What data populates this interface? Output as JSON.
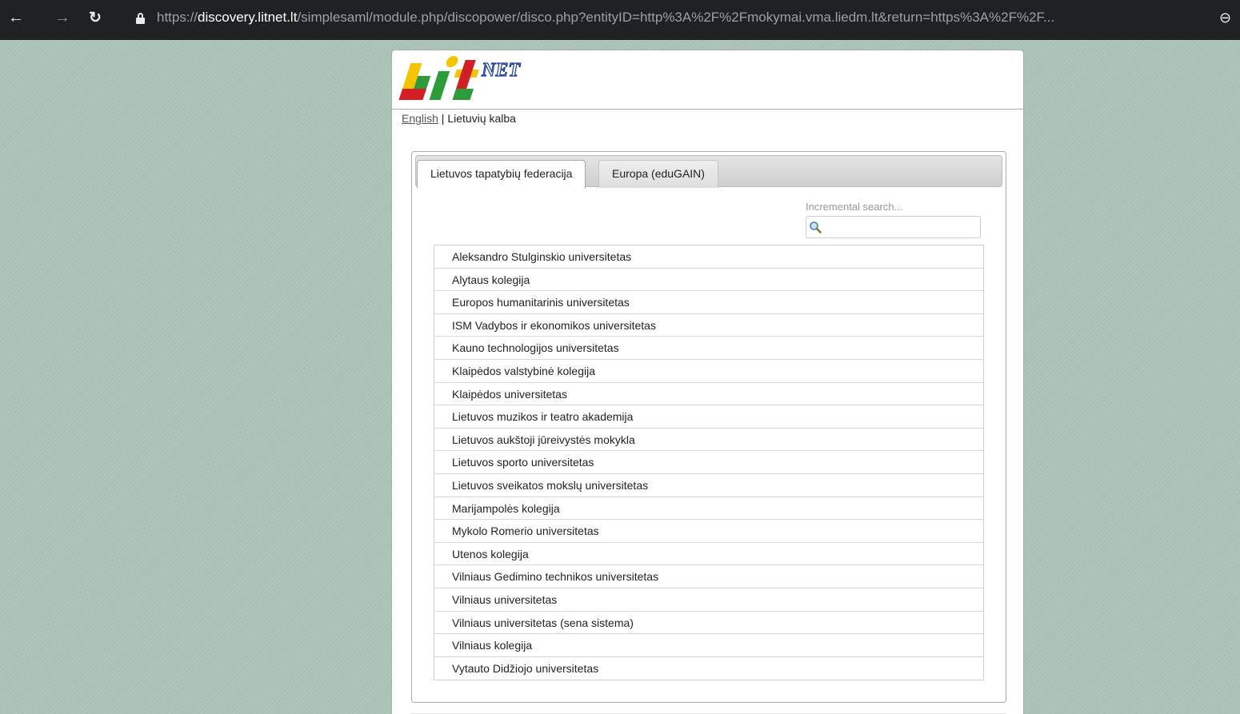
{
  "browser": {
    "url_scheme": "https://",
    "url_host": "discovery.litnet.lt",
    "url_path": "/simplesaml/module.php/discopower/disco.php?entityID=http%3A%2F%2Fmokymai.vma.liedm.lt&return=https%3A%2F%2F...",
    "back_icon": "arrow-left-icon",
    "forward_icon": "arrow-right-icon",
    "reload_icon": "reload-icon",
    "zoom_icon": "zoom-icon"
  },
  "logo": {
    "text_main": "Lit",
    "text_sup": "NET"
  },
  "language": {
    "english": "English",
    "separator": " | ",
    "lithuanian": "Lietuvių kalba"
  },
  "tabs": [
    {
      "label": "Lietuvos tapatybių federacija",
      "active": true
    },
    {
      "label": "Europa (eduGAIN)",
      "active": false
    }
  ],
  "search": {
    "placeholder": "Incremental search...",
    "value": ""
  },
  "institutions": [
    "Aleksandro Stulginskio universitetas",
    "Alytaus kolegija",
    "Europos humanitarinis universitetas",
    "ISM Vadybos ir ekonomikos universitetas",
    "Kauno technologijos universitetas",
    "Klaipėdos valstybinė kolegija",
    "Klaipėdos universitetas",
    "Lietuvos muzikos ir teatro akademija",
    "Lietuvos aukštoji jūreivystės mokykla",
    "Lietuvos sporto universitetas",
    "Lietuvos sveikatos mokslų universitetas",
    "Marijampolės kolegija",
    "Mykolo Romerio universitetas",
    "Utenos kolegija",
    "Vilniaus Gedimino technikos universitetas",
    "Vilniaus universitetas",
    "Vilniaus universitetas (sena sistema)",
    "Vilniaus kolegija",
    "Vytauto Didžiojo universitetas"
  ],
  "colors": {
    "background": "#a9c2b5",
    "logo_red": "#d21f26",
    "logo_yellow": "#f5c400",
    "logo_green": "#2e9b3a",
    "logo_blue": "#1a3a9c"
  }
}
